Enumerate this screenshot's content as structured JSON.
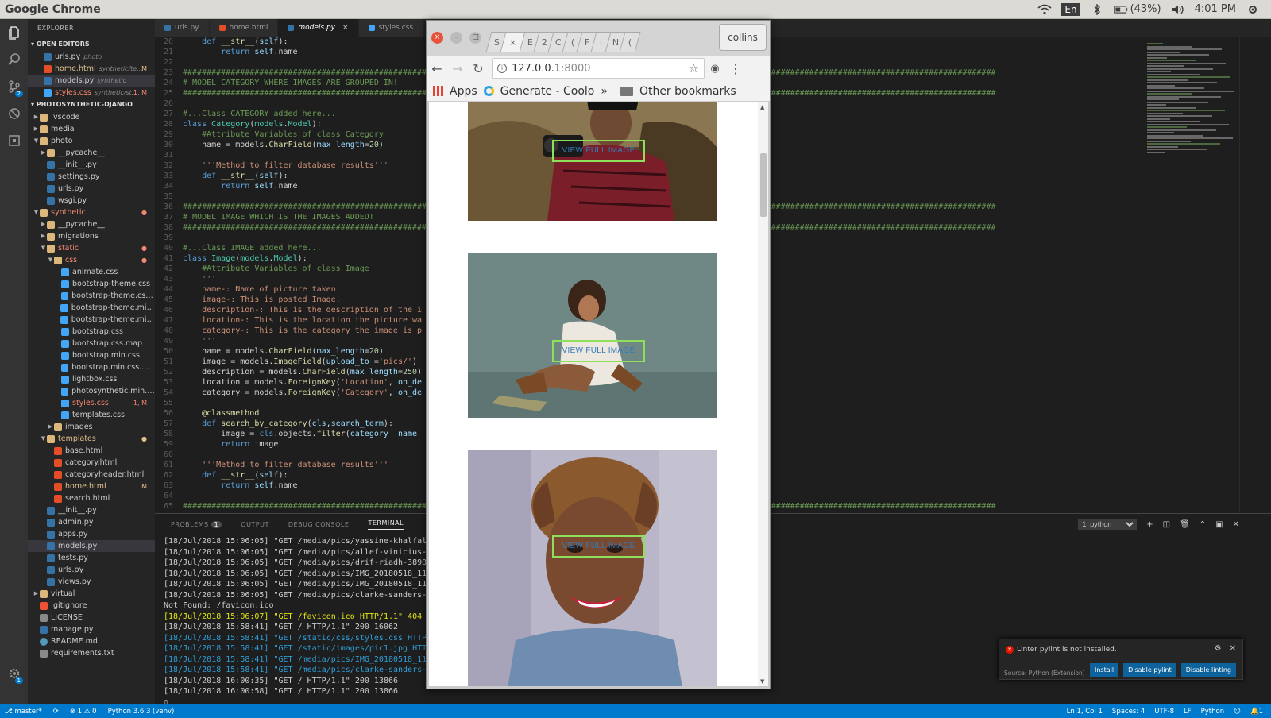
{
  "system_bar": {
    "app_name": "Google Chrome",
    "lang": "En",
    "battery": "(43%)",
    "time": "4:01 PM"
  },
  "activity_bar": {
    "icons": [
      "files-icon",
      "search-icon",
      "source-control-icon",
      "debug-icon",
      "extensions-icon",
      "settings-gear-icon"
    ],
    "scm_badge": "2",
    "settings_badge": "1"
  },
  "explorer": {
    "title": "EXPLORER",
    "open_editors_label": "OPEN EDITORS",
    "open_editors": [
      {
        "name": "urls.py",
        "sub": "photo",
        "type": "py",
        "badge": ""
      },
      {
        "name": "home.html",
        "sub": "synthetic/te...",
        "type": "html",
        "badge": "M"
      },
      {
        "name": "models.py",
        "sub": "synthetic",
        "type": "py",
        "badge": ""
      },
      {
        "name": "styles.css",
        "sub": "synthetic/st...",
        "type": "css",
        "badge": "1, M"
      }
    ],
    "project_label": "PHOTOSYNTHETIC-DJANGO",
    "tree": [
      {
        "name": ".vscode",
        "type": "folder",
        "indent": 0,
        "tw": "▶",
        "badge": ""
      },
      {
        "name": "media",
        "type": "folder",
        "indent": 0,
        "tw": "▶",
        "badge": ""
      },
      {
        "name": "photo",
        "type": "folder",
        "indent": 0,
        "tw": "▼",
        "badge": ""
      },
      {
        "name": "__pycache__",
        "type": "folder",
        "indent": 1,
        "tw": "▶",
        "badge": ""
      },
      {
        "name": "__init__.py",
        "type": "py",
        "indent": 1,
        "tw": "",
        "badge": ""
      },
      {
        "name": "settings.py",
        "type": "py",
        "indent": 1,
        "tw": "",
        "badge": ""
      },
      {
        "name": "urls.py",
        "type": "py",
        "indent": 1,
        "tw": "",
        "badge": ""
      },
      {
        "name": "wsgi.py",
        "type": "py",
        "indent": 1,
        "tw": "",
        "badge": ""
      },
      {
        "name": "synthetic",
        "type": "folder",
        "indent": 0,
        "tw": "▼",
        "badge": "●",
        "red": true
      },
      {
        "name": "__pycache__",
        "type": "folder",
        "indent": 1,
        "tw": "▶",
        "badge": ""
      },
      {
        "name": "migrations",
        "type": "folder",
        "indent": 1,
        "tw": "▶",
        "badge": ""
      },
      {
        "name": "static",
        "type": "folder",
        "indent": 1,
        "tw": "▼",
        "badge": "●",
        "red": true
      },
      {
        "name": "css",
        "type": "folder",
        "indent": 2,
        "tw": "▼",
        "badge": "●",
        "red": true
      },
      {
        "name": "animate.css",
        "type": "css",
        "indent": 3,
        "tw": "",
        "badge": ""
      },
      {
        "name": "bootstrap-theme.css",
        "type": "css",
        "indent": 3,
        "tw": "",
        "badge": ""
      },
      {
        "name": "bootstrap-theme.css....",
        "type": "css",
        "indent": 3,
        "tw": "",
        "badge": ""
      },
      {
        "name": "bootstrap-theme.min....",
        "type": "css",
        "indent": 3,
        "tw": "",
        "badge": ""
      },
      {
        "name": "bootstrap-theme.min....",
        "type": "css",
        "indent": 3,
        "tw": "",
        "badge": ""
      },
      {
        "name": "bootstrap.css",
        "type": "css",
        "indent": 3,
        "tw": "",
        "badge": ""
      },
      {
        "name": "bootstrap.css.map",
        "type": "css",
        "indent": 3,
        "tw": "",
        "badge": ""
      },
      {
        "name": "bootstrap.min.css",
        "type": "css",
        "indent": 3,
        "tw": "",
        "badge": ""
      },
      {
        "name": "bootstrap.min.css.map",
        "type": "css",
        "indent": 3,
        "tw": "",
        "badge": ""
      },
      {
        "name": "lightbox.css",
        "type": "css",
        "indent": 3,
        "tw": "",
        "badge": ""
      },
      {
        "name": "photosynthetic.min.css",
        "type": "css",
        "indent": 3,
        "tw": "",
        "badge": ""
      },
      {
        "name": "styles.css",
        "type": "css",
        "indent": 3,
        "tw": "",
        "badge": "1, M",
        "red": true
      },
      {
        "name": "templates.css",
        "type": "css",
        "indent": 3,
        "tw": "",
        "badge": ""
      },
      {
        "name": "images",
        "type": "folder",
        "indent": 2,
        "tw": "▶",
        "badge": ""
      },
      {
        "name": "templates",
        "type": "folder",
        "indent": 1,
        "tw": "▼",
        "badge": "●",
        "yellow": true
      },
      {
        "name": "base.html",
        "type": "html",
        "indent": 2,
        "tw": "",
        "badge": ""
      },
      {
        "name": "category.html",
        "type": "html",
        "indent": 2,
        "tw": "",
        "badge": ""
      },
      {
        "name": "categoryheader.html",
        "type": "html",
        "indent": 2,
        "tw": "",
        "badge": ""
      },
      {
        "name": "home.html",
        "type": "html",
        "indent": 2,
        "tw": "",
        "badge": "M",
        "yellow": true
      },
      {
        "name": "search.html",
        "type": "html",
        "indent": 2,
        "tw": "",
        "badge": ""
      },
      {
        "name": "__init__.py",
        "type": "py",
        "indent": 1,
        "tw": "",
        "badge": ""
      },
      {
        "name": "admin.py",
        "type": "py",
        "indent": 1,
        "tw": "",
        "badge": ""
      },
      {
        "name": "apps.py",
        "type": "py",
        "indent": 1,
        "tw": "",
        "badge": ""
      },
      {
        "name": "models.py",
        "type": "py",
        "indent": 1,
        "tw": "",
        "badge": "",
        "sel": true
      },
      {
        "name": "tests.py",
        "type": "py",
        "indent": 1,
        "tw": "",
        "badge": ""
      },
      {
        "name": "urls.py",
        "type": "py",
        "indent": 1,
        "tw": "",
        "badge": ""
      },
      {
        "name": "views.py",
        "type": "py",
        "indent": 1,
        "tw": "",
        "badge": ""
      },
      {
        "name": "virtual",
        "type": "folder",
        "indent": 0,
        "tw": "▶",
        "badge": ""
      },
      {
        "name": ".gitignore",
        "type": "git",
        "indent": 0,
        "tw": "",
        "badge": ""
      },
      {
        "name": "LICENSE",
        "type": "txt",
        "indent": 0,
        "tw": "",
        "badge": ""
      },
      {
        "name": "manage.py",
        "type": "py",
        "indent": 0,
        "tw": "",
        "badge": ""
      },
      {
        "name": "README.md",
        "type": "md",
        "indent": 0,
        "tw": "",
        "badge": ""
      },
      {
        "name": "requirements.txt",
        "type": "txt",
        "indent": 0,
        "tw": "",
        "badge": ""
      }
    ]
  },
  "editor_tabs": [
    {
      "name": "urls.py",
      "type": "py",
      "active": false
    },
    {
      "name": "home.html",
      "type": "html",
      "active": false
    },
    {
      "name": "models.py",
      "type": "py",
      "active": true,
      "close": "×"
    },
    {
      "name": "styles.css",
      "type": "css",
      "active": false
    }
  ],
  "code_lines": [
    {
      "n": "20",
      "html": "    <span class=\"kw\">def</span> <span class=\"fn\">__str__</span>(<span class=\"sf\">self</span>):"
    },
    {
      "n": "21",
      "html": "        <span class=\"kw\">return</span> <span class=\"sf\">self</span>.name"
    },
    {
      "n": "22",
      "html": ""
    },
    {
      "n": "23",
      "html": "<span class=\"cm\">##########################################################################################################################################################################</span>"
    },
    {
      "n": "24",
      "html": "<span class=\"cm\"># MODEL CATEGORY WHERE IMAGES ARE GROUPED IN!</span>"
    },
    {
      "n": "25",
      "html": "<span class=\"cm\">##########################################################################################################################################################################</span>"
    },
    {
      "n": "26",
      "html": ""
    },
    {
      "n": "27",
      "html": "<span class=\"cm\">#...Class CATEGORY added here...</span>"
    },
    {
      "n": "28",
      "html": "<span class=\"kw\">class</span> <span class=\"cls\">Category</span>(<span class=\"cls\">models</span>.<span class=\"cls\">Model</span>):"
    },
    {
      "n": "29",
      "html": "    <span class=\"cm\">#Attribute Variables of class Category</span>"
    },
    {
      "n": "30",
      "html": "    name = models.<span class=\"fn\">CharField</span>(<span class=\"sf\">max_length</span>=<span class=\"nm\">20</span>)"
    },
    {
      "n": "31",
      "html": ""
    },
    {
      "n": "32",
      "html": "    <span class=\"st\">'''Method to filter database results'''</span>"
    },
    {
      "n": "33",
      "html": "    <span class=\"kw\">def</span> <span class=\"fn\">__str__</span>(<span class=\"sf\">self</span>):"
    },
    {
      "n": "34",
      "html": "        <span class=\"kw\">return</span> <span class=\"sf\">self</span>.name"
    },
    {
      "n": "35",
      "html": ""
    },
    {
      "n": "36",
      "html": "<span class=\"cm\">##########################################################################################################################################################################</span>"
    },
    {
      "n": "37",
      "html": "<span class=\"cm\"># MODEL IMAGE WHICH IS THE IMAGES ADDED!</span>"
    },
    {
      "n": "38",
      "html": "<span class=\"cm\">##########################################################################################################################################################################</span>"
    },
    {
      "n": "39",
      "html": ""
    },
    {
      "n": "40",
      "html": "<span class=\"cm\">#...Class IMAGE added here...</span>"
    },
    {
      "n": "41",
      "html": "<span class=\"kw\">class</span> <span class=\"cls\">Image</span>(<span class=\"cls\">models</span>.<span class=\"cls\">Model</span>):"
    },
    {
      "n": "42",
      "html": "    <span class=\"cm\">#Attribute Variables of class Image</span>"
    },
    {
      "n": "43",
      "html": "    <span class=\"st\">'''</span>"
    },
    {
      "n": "44",
      "html": "    <span class=\"st\">name-: Name of picture taken.</span>"
    },
    {
      "n": "45",
      "html": "    <span class=\"st\">image-: This is posted Image.</span>"
    },
    {
      "n": "46",
      "html": "    <span class=\"st\">description-: This is the description of the i</span>"
    },
    {
      "n": "47",
      "html": "    <span class=\"st\">location-: This is the location the picture wa</span>"
    },
    {
      "n": "48",
      "html": "    <span class=\"st\">category-: This is the category the image is p</span>"
    },
    {
      "n": "49",
      "html": "    <span class=\"st\">'''</span>"
    },
    {
      "n": "50",
      "html": "    name = models.<span class=\"fn\">CharField</span>(<span class=\"sf\">max_length</span>=<span class=\"nm\">20</span>)"
    },
    {
      "n": "51",
      "html": "    image = models.<span class=\"fn\">ImageField</span>(<span class=\"sf\">upload_to</span> =<span class=\"st\">'pics/'</span>)"
    },
    {
      "n": "52",
      "html": "    description = models.<span class=\"fn\">CharField</span>(<span class=\"sf\">max_length</span>=<span class=\"nm\">250</span>)"
    },
    {
      "n": "53",
      "html": "    location = models.<span class=\"fn\">ForeignKey</span>(<span class=\"st\">'Location'</span>, <span class=\"sf\">on_de</span>"
    },
    {
      "n": "54",
      "html": "    category = models.<span class=\"fn\">ForeignKey</span>(<span class=\"st\">'Category'</span>, <span class=\"sf\">on_de</span>"
    },
    {
      "n": "55",
      "html": ""
    },
    {
      "n": "56",
      "html": "    <span class=\"dc\">@classmethod</span>"
    },
    {
      "n": "57",
      "html": "    <span class=\"kw\">def</span> <span class=\"fn\">search_by_category</span>(<span class=\"sf\">cls</span>,<span class=\"sf\">search_term</span>):"
    },
    {
      "n": "58",
      "html": "        image = <span class=\"kw\">cls</span>.objects.<span class=\"fn\">filter</span>(<span class=\"sf\">category__name_</span>"
    },
    {
      "n": "59",
      "html": "        <span class=\"kw\">return</span> image"
    },
    {
      "n": "60",
      "html": ""
    },
    {
      "n": "61",
      "html": "    <span class=\"st\">'''Method to filter database results'''</span>"
    },
    {
      "n": "62",
      "html": "    <span class=\"kw\">def</span> <span class=\"fn\">__str__</span>(<span class=\"sf\">self</span>):"
    },
    {
      "n": "63",
      "html": "        <span class=\"kw\">return</span> <span class=\"sf\">self</span>.name"
    },
    {
      "n": "64",
      "html": ""
    },
    {
      "n": "65",
      "html": "<span class=\"cm\">##########################################################################################################################################################################</span>"
    },
    {
      "n": "66",
      "html": ""
    }
  ],
  "panel": {
    "tabs": [
      "PROBLEMS",
      "OUTPUT",
      "DEBUG CONSOLE",
      "TERMINAL"
    ],
    "problems_count": "1",
    "terminal_select": "1: python",
    "terminal_lines": [
      {
        "t": "[18/Jul/2018 15:06:05] \"GET /media/pics/yassine-khalfall",
        "c": ""
      },
      {
        "t": "[18/Jul/2018 15:06:05] \"GET /media/pics/allef-vinicius-3",
        "c": ""
      },
      {
        "t": "[18/Jul/2018 15:06:05] \"GET /media/pics/drif-riadh-38908",
        "c": ""
      },
      {
        "t": "[18/Jul/2018 15:06:05] \"GET /media/pics/IMG_20180518_115",
        "c": ""
      },
      {
        "t": "[18/Jul/2018 15:06:05] \"GET /media/pics/IMG_20180518_115",
        "c": ""
      },
      {
        "t": "[18/Jul/2018 15:06:05] \"GET /media/pics/clarke-sanders-2",
        "c": ""
      },
      {
        "t": "Not Found: /favicon.ico",
        "c": ""
      },
      {
        "t": "[18/Jul/2018 15:06:07] \"GET /favicon.ico HTTP/1.1\" 404 2",
        "c": "y"
      },
      {
        "t": "[18/Jul/2018 15:58:41] \"GET / HTTP/1.1\" 200 16062",
        "c": ""
      },
      {
        "t": "[18/Jul/2018 15:58:41] \"GET /static/css/styles.css HTTP/",
        "c": "b"
      },
      {
        "t": "[18/Jul/2018 15:58:41] \"GET /static/images/pic1.jpg HTTP",
        "c": "b"
      },
      {
        "t": "[18/Jul/2018 15:58:41] \"GET /media/pics/IMG_20180518_115",
        "c": "b"
      },
      {
        "t": "[18/Jul/2018 15:58:41] \"GET /media/pics/clarke-sanders-2",
        "c": "b"
      },
      {
        "t": "[18/Jul/2018 16:00:35] \"GET / HTTP/1.1\" 200 13866",
        "c": ""
      },
      {
        "t": "[18/Jul/2018 16:00:58] \"GET / HTTP/1.1\" 200 13866",
        "c": ""
      },
      {
        "t": "▯",
        "c": ""
      }
    ]
  },
  "notification": {
    "message": "Linter pylint is not installed.",
    "source": "Source: Python (Extension)",
    "buttons": [
      "Install",
      "Disable pylint",
      "Disable linting"
    ]
  },
  "statusbar": {
    "branch": "master*",
    "errors": "1",
    "warnings": "0",
    "interpreter": "Python 3.6.3 (venv)",
    "position": "Ln 1, Col 1",
    "spaces": "Spaces: 4",
    "encoding": "UTF-8",
    "eol": "LF",
    "language": "Python",
    "notif_count": "1"
  },
  "chrome": {
    "tab_letters": [
      "S",
      "×",
      "E",
      "2",
      "C",
      "(",
      "F",
      "I",
      "N",
      "("
    ],
    "profile": "collins",
    "url_host": "127.0.0.1",
    "url_port": ":8000",
    "bookmarks": {
      "apps": "Apps",
      "generate": "Generate - Coolo",
      "more": "»",
      "other": "Other bookmarks"
    },
    "gallery": [
      {
        "button": "VIEW FULL IMAGE"
      },
      {
        "button": "VIEW FULL IMAGE"
      },
      {
        "button": "VIEW FULL IMAGE"
      }
    ]
  }
}
